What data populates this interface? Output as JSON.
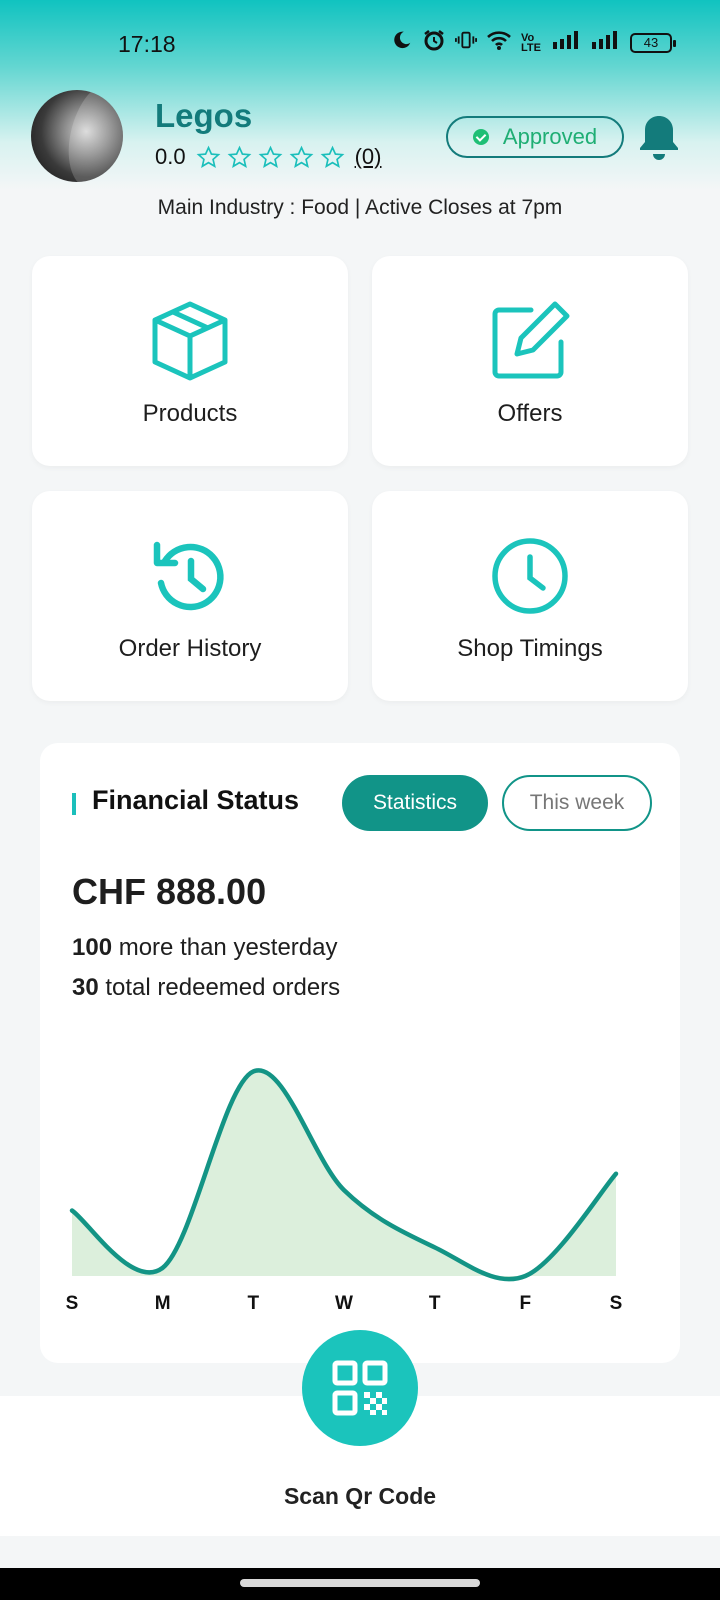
{
  "status_bar": {
    "time": "17:18",
    "network_label": "Vo LTE",
    "battery": "43"
  },
  "header": {
    "shop_name": "Legos",
    "rating_value": "0.0",
    "rating_count": "(0)",
    "stars_filled": 0,
    "stars_total": 5,
    "approved_label": "Approved",
    "info_line": "Main Industry : Food  | Active Closes at 7pm"
  },
  "tiles": {
    "products": "Products",
    "offers": "Offers",
    "order_history": "Order History",
    "shop_timings": "Shop Timings"
  },
  "financial": {
    "title": "Financial Status",
    "statistics_label": "Statistics",
    "period_label": "This week",
    "amount": "CHF 888.00",
    "stat1_value": "100",
    "stat1_text": " more than yesterday",
    "stat2_value": "30",
    "stat2_text": " total redeemed orders"
  },
  "chart_data": {
    "type": "area",
    "categories": [
      "S",
      "M",
      "T",
      "W",
      "T",
      "F",
      "S"
    ],
    "values": [
      32,
      4,
      100,
      42,
      14,
      0,
      50
    ],
    "ylim": [
      0,
      110
    ],
    "grid": false,
    "line_color": "#139485",
    "fill_color": "#dcefdc"
  },
  "bottom": {
    "scan_label": "Scan Qr Code"
  },
  "colors": {
    "accent": "#1bc4bc",
    "primary_dark": "#137b7b",
    "button_fill": "#119488",
    "approved_green": "#1fae74"
  }
}
